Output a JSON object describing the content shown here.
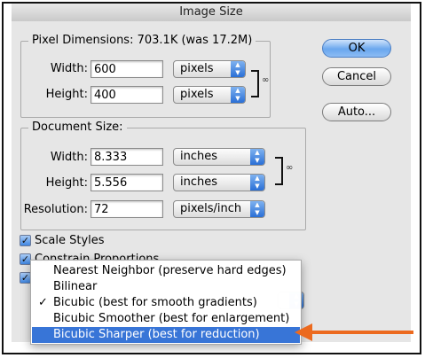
{
  "window": {
    "title": "Image Size"
  },
  "pixel_dimensions": {
    "legend": "Pixel Dimensions:",
    "size_text": "703.1K (was 17.2M)",
    "width_label": "Width:",
    "width_value": "600",
    "width_unit": "pixels",
    "height_label": "Height:",
    "height_value": "400",
    "height_unit": "pixels"
  },
  "document_size": {
    "legend": "Document Size:",
    "width_label": "Width:",
    "width_value": "8.333",
    "width_unit": "inches",
    "height_label": "Height:",
    "height_value": "5.556",
    "height_unit": "inches",
    "resolution_label": "Resolution:",
    "resolution_value": "72",
    "resolution_unit": "pixels/inch"
  },
  "buttons": {
    "ok": "OK",
    "cancel": "Cancel",
    "auto": "Auto..."
  },
  "checkboxes": {
    "scale_styles": "Scale Styles",
    "constrain_proportions": "Constrain Proportions"
  },
  "resample_menu": {
    "checkmark": "✓",
    "items": [
      "Nearest Neighbor (preserve hard edges)",
      "Bilinear",
      "Bicubic (best for smooth gradients)",
      "Bicubic Smoother (best for enlargement)",
      "Bicubic Sharper (best for reduction)"
    ]
  },
  "colors": {
    "highlight": "#3875d7",
    "annotation_arrow": "#ec6a1f"
  }
}
